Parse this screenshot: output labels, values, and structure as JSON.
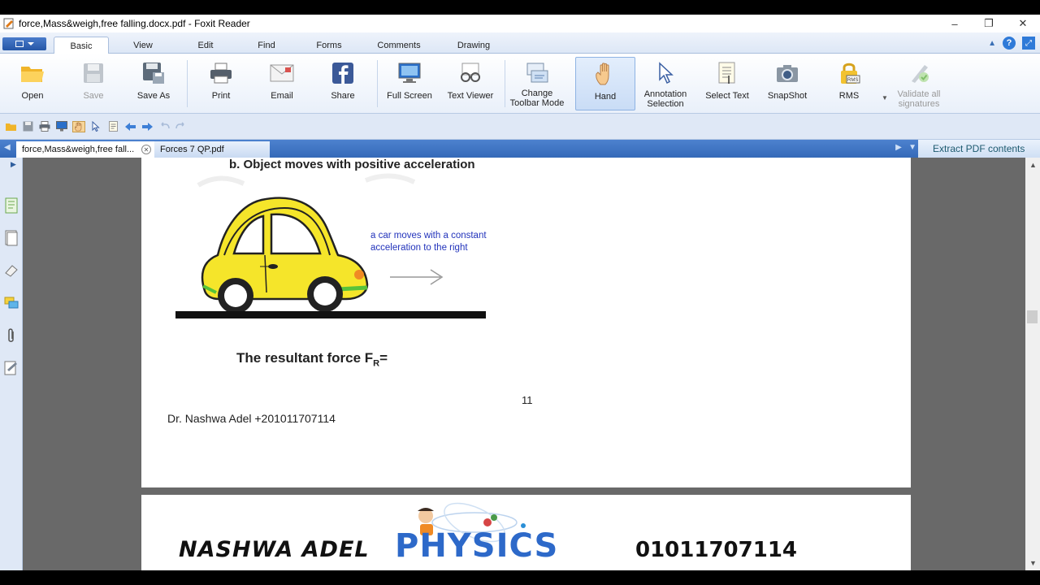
{
  "window": {
    "title": "force,Mass&weigh,free falling.docx.pdf - Foxit Reader",
    "controls": [
      "–",
      "❐",
      "✕"
    ]
  },
  "ribbon_tabs": [
    "Basic",
    "View",
    "Edit",
    "Find",
    "Forms",
    "Comments",
    "Drawing"
  ],
  "active_ribbon_tab": "Basic",
  "ribbon": {
    "open": "Open",
    "save": "Save",
    "save_as": "Save As",
    "print": "Print",
    "email": "Email",
    "share": "Share",
    "full_screen": "Full Screen",
    "text_viewer": "Text Viewer",
    "change_toolbar_1": "Change",
    "change_toolbar_2": "Toolbar Mode",
    "hand": "Hand",
    "annotation_1": "Annotation",
    "annotation_2": "Selection",
    "select_text": "Select Text",
    "snapshot": "SnapShot",
    "rms": "RMS",
    "validate_1": "Validate all",
    "validate_2": "signatures"
  },
  "doc_tabs": {
    "tab1": "force,Mass&weigh,free fall...",
    "tab2": "Forces 7 QP.pdf",
    "extract": "Extract PDF contents"
  },
  "page": {
    "heading": "b.   Object moves with positive acceleration",
    "annotation_line1": "a car moves with  a constant",
    "annotation_line2": "acceleration to the right",
    "resultant_label": "The resultant force F",
    "resultant_sub": "R",
    "resultant_eq": "=",
    "page_number": "11",
    "footer": "Dr. Nashwa Adel  +201011707114"
  },
  "banner": {
    "name": "NASHWA ADEL",
    "logo": "PHYSICS",
    "phone": "01011707114"
  },
  "colors": {
    "ribbon_bg": "#e9f0fa",
    "tab_strip": "#3469b8",
    "doc_background": "#696969",
    "car_body": "#f5e52a",
    "annotation_text": "#2233bb",
    "logo_blue": "#2d69c9"
  }
}
